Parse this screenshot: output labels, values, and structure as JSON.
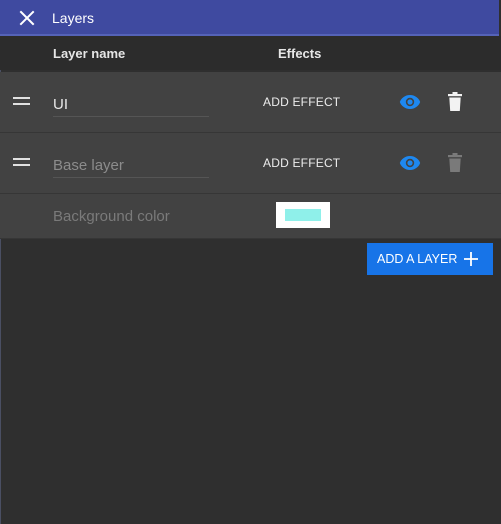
{
  "window": {
    "title": "Layers",
    "close_icon": "close-icon"
  },
  "table": {
    "headers": {
      "layer_name": "Layer name",
      "effects": "Effects"
    },
    "layers": [
      {
        "name": "UI",
        "add_effect_label": "ADD EFFECT",
        "visible": true,
        "deletable": true
      },
      {
        "name": "Base layer",
        "add_effect_label": "ADD EFFECT",
        "visible": true,
        "deletable": false
      }
    ],
    "background": {
      "label": "Background color",
      "color": "#8ff0ea"
    }
  },
  "actions": {
    "add_layer_label": "ADD A LAYER"
  },
  "colors": {
    "accent": "#1774e8",
    "titlebar": "#3f4aa0",
    "eye_icon": "#1e88f0"
  }
}
